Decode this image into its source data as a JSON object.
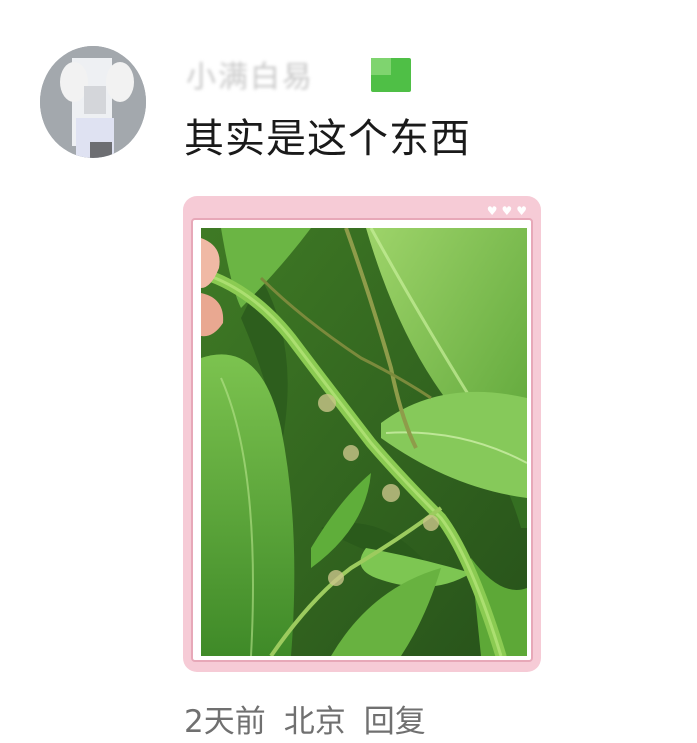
{
  "comment": {
    "username": "小满白易",
    "text": "其实是这个东西",
    "time": "2天前",
    "location": "北京",
    "reply_label": "回复"
  },
  "icons": {
    "avatar": "avatar-image",
    "level_badge": "level-badge-icon",
    "hearts": [
      "heart-icon",
      "heart-icon",
      "heart-icon"
    ]
  },
  "photo": {
    "subject": "bamboo-branch"
  },
  "colors": {
    "frame": "#f6cbd6",
    "frame_border": "#e7a8b8",
    "badge": "#4fbf46",
    "text": "#1a1a1a",
    "meta": "#707070"
  }
}
